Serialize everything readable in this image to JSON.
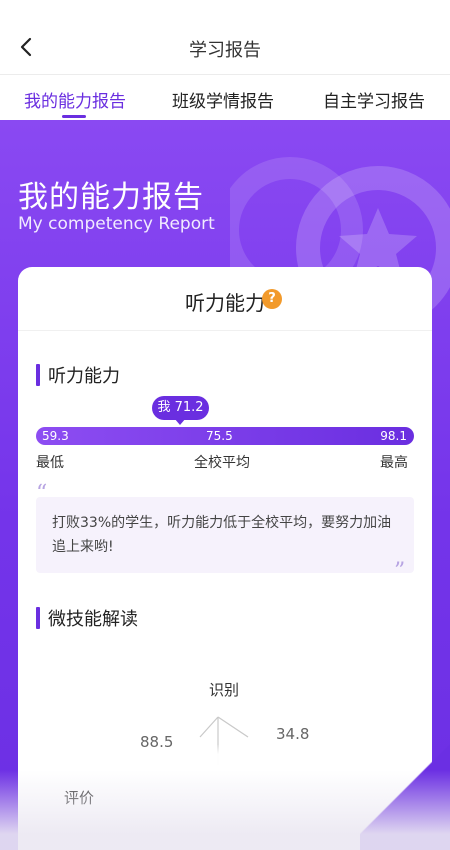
{
  "nav": {
    "title": "学习报告",
    "back_icon": "chevron-left-icon"
  },
  "tabs": [
    {
      "label": "我的能力报告",
      "active": true
    },
    {
      "label": "班级学情报告",
      "active": false
    },
    {
      "label": "自主学习报告",
      "active": false
    }
  ],
  "hero": {
    "title": "我的能力报告",
    "subtitle": "My competency Report",
    "decor_icon": "star-medal-icon"
  },
  "card": {
    "title": "听力能力",
    "help_label": "?",
    "section_title": "听力能力",
    "score": {
      "badge": "我 71.2",
      "value": 71.2,
      "min_value": "59.3",
      "avg_value": "75.5",
      "max_value": "98.1",
      "min_label": "最低",
      "avg_label": "全校平均",
      "max_label": "最高"
    },
    "quote": {
      "open_mark": "“",
      "close_mark": "”",
      "text": "打败33%的学生，听力能力低于全校平均，要努力加油追上来哟!"
    },
    "micro": {
      "section_title": "微技能解读",
      "axis_top": "识别",
      "axis_left": "评价",
      "value_right": "34.8",
      "value_left": "88.5"
    }
  },
  "colors": {
    "accent": "#6a2ee0",
    "hero_top": "#8a49f2",
    "hero_bottom": "#6b2fe3",
    "help": "#f29a2b",
    "quote_bg": "#f6f2fc"
  }
}
